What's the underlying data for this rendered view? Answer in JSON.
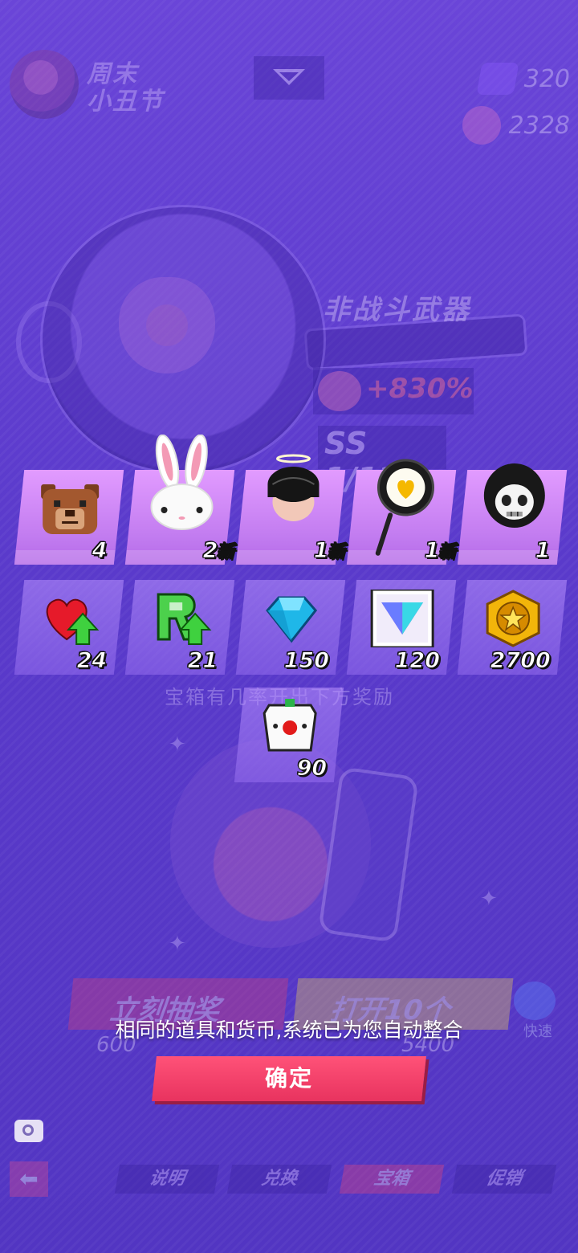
{
  "background": {
    "event_title": "周末\n小丑节",
    "currencies": [
      {
        "icon": "purple-gem-icon",
        "value": "320"
      },
      {
        "icon": "pink-token-icon",
        "value": "2328"
      }
    ],
    "weapon_category": "非战斗武器",
    "boost_value": "+830%",
    "rank_text": "SS 1/12",
    "chest_subtitle": "宝箱有几率开出下方奖励",
    "draw_button": "立刻抽奖",
    "draw_price": "600",
    "open_button": "打开10个",
    "open_price": "5400",
    "quick_label": "快速",
    "nav_tabs": [
      "说明",
      "兑换",
      "宝箱",
      "促销"
    ],
    "active_tab": "宝箱"
  },
  "rewards": {
    "row1": [
      {
        "icon": "bear-head-icon",
        "count": "4",
        "new": ""
      },
      {
        "icon": "bunny-head-icon",
        "count": "2",
        "new": "新"
      },
      {
        "icon": "black-hair-head-icon",
        "count": "1",
        "new": "新"
      },
      {
        "icon": "heart-frying-pan-icon",
        "count": "1",
        "new": "新"
      },
      {
        "icon": "skull-hood-head-icon",
        "count": "1",
        "new": ""
      }
    ],
    "row2": [
      {
        "icon": "heart-upgrade-icon",
        "count": "24"
      },
      {
        "icon": "r-upgrade-icon",
        "count": "21"
      },
      {
        "icon": "blue-diamond-icon",
        "count": "150"
      },
      {
        "icon": "prism-crystal-icon",
        "count": "120"
      },
      {
        "icon": "gold-star-coin-icon",
        "count": "2700"
      }
    ],
    "row3": [
      {
        "icon": "clown-cube-icon",
        "count": "90"
      }
    ]
  },
  "dialog": {
    "message": "相同的道具和货币,系统已为您自动整合",
    "confirm_label": "确定"
  },
  "colors": {
    "background": "#5b3ad0",
    "confirm": "#e8335f",
    "tile_highlight": "#c27cf0"
  }
}
